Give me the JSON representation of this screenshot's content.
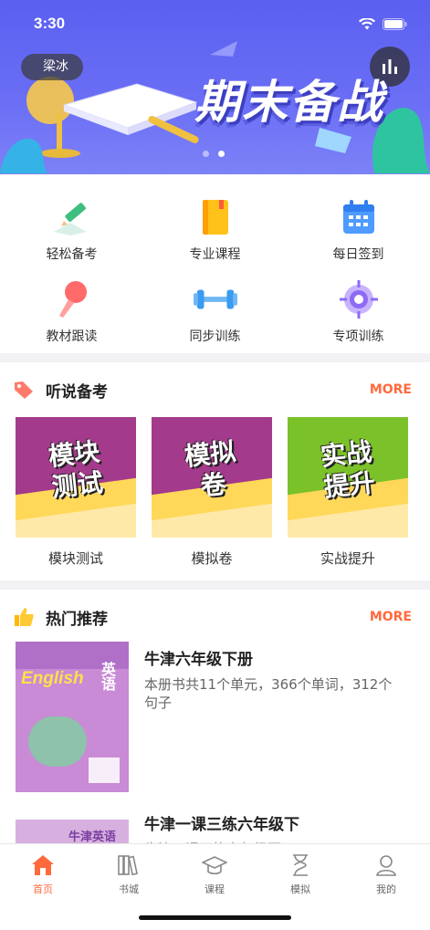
{
  "status_bar": {
    "time": "3:30"
  },
  "banner": {
    "user_name": "梁冰",
    "title": "期末备战",
    "page_count": 2,
    "active_page": 1
  },
  "menu": [
    {
      "label": "轻松备考",
      "icon": "pencil-icon"
    },
    {
      "label": "专业课程",
      "icon": "book-icon"
    },
    {
      "label": "每日签到",
      "icon": "calendar-icon"
    },
    {
      "label": "教材跟读",
      "icon": "microphone-icon"
    },
    {
      "label": "同步训练",
      "icon": "dumbbell-icon"
    },
    {
      "label": "专项训练",
      "icon": "target-icon"
    }
  ],
  "listening": {
    "title": "听说备考",
    "more": "MORE",
    "cards": [
      {
        "caption": "模块测试",
        "art_text": "模块\n测试",
        "bg": "#a33a8b"
      },
      {
        "caption": "模拟卷",
        "art_text": "模拟\n卷",
        "bg": "#a33a8b"
      },
      {
        "caption": "实战提升",
        "art_text": "实战\n提升",
        "bg": "#7bc12a"
      }
    ]
  },
  "recommend": {
    "title": "热门推荐",
    "more": "MORE",
    "items": [
      {
        "title": "牛津六年级下册",
        "desc": "本册书共11个单元，366个单词，312个句子",
        "cover_text": "English",
        "cover_cn": "英语"
      },
      {
        "title": "牛津一课三练六年级下",
        "desc": "牛津一课三练六年级下",
        "cover_text": "牛津英语",
        "cover_cn": ""
      }
    ]
  },
  "tabs": [
    {
      "label": "首页",
      "icon": "home-icon",
      "active": true
    },
    {
      "label": "书城",
      "icon": "bookshelf-icon",
      "active": false
    },
    {
      "label": "课程",
      "icon": "graduation-cap-icon",
      "active": false
    },
    {
      "label": "模拟",
      "icon": "hourglass-icon",
      "active": false
    },
    {
      "label": "我的",
      "icon": "profile-icon",
      "active": false
    }
  ],
  "colors": {
    "accent": "#ff6a3d",
    "banner": "#5a5ff0",
    "listen_purple": "#a33a8b",
    "listen_green": "#7bc12a"
  }
}
